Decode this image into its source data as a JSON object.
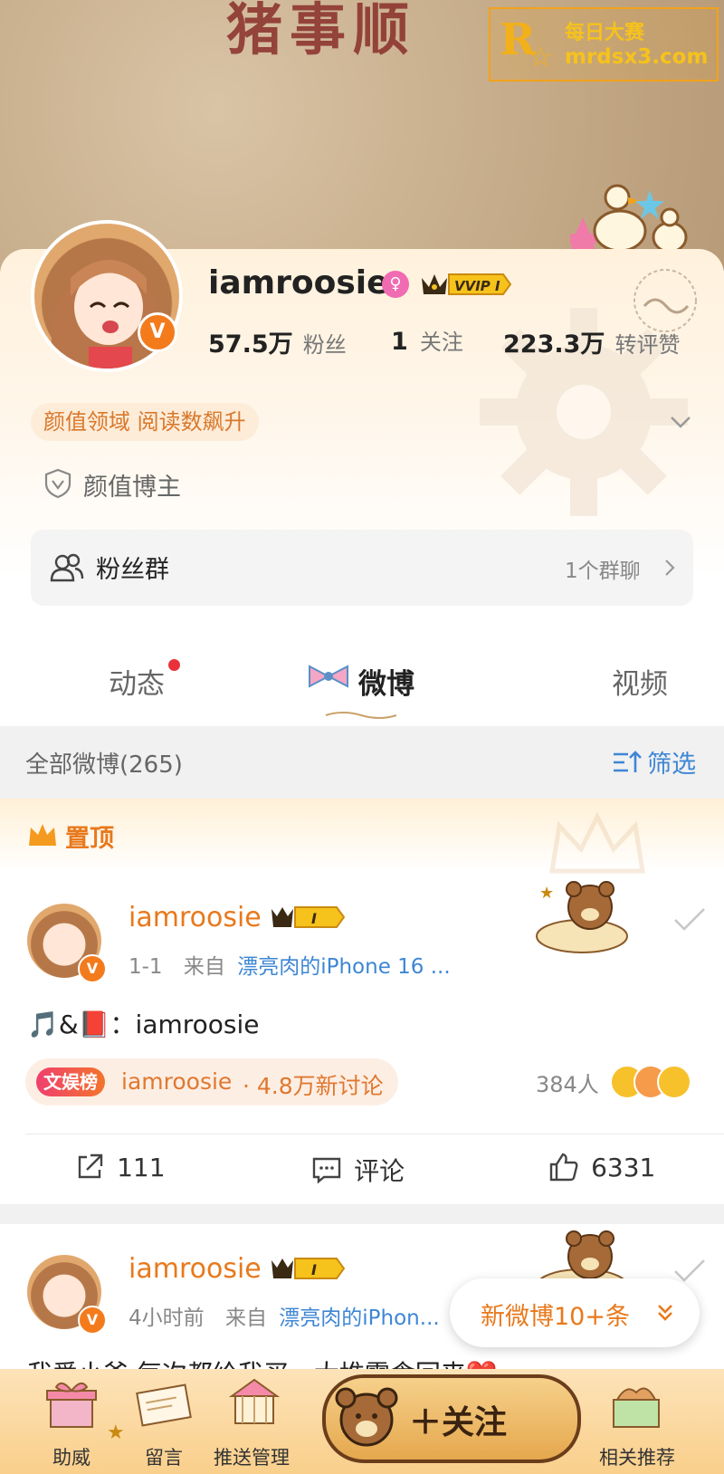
{
  "cover": {
    "title_text": "猪事顺"
  },
  "watermark": {
    "logo": "R",
    "line1": "每日大赛",
    "line2": "mrdsx3.com"
  },
  "profile": {
    "username": "iamroosie",
    "vvip_label": "VVIP I",
    "stats": [
      {
        "value": "57.5万",
        "label": "粉丝"
      },
      {
        "value": "1",
        "label": "关注"
      },
      {
        "value": "223.3万",
        "label": "转评赞"
      }
    ],
    "tag": "颜值领域 阅读数飙升",
    "role": "颜值博主",
    "fan_group": {
      "label": "粉丝群",
      "right": "1个群聊"
    }
  },
  "tabs": [
    {
      "label": "动态",
      "has_dot": true
    },
    {
      "label": "微博",
      "active": true
    },
    {
      "label": "视频"
    }
  ],
  "feed": {
    "all_posts": "全部微博(265)",
    "filter": "筛选"
  },
  "pinned": {
    "label": "置顶"
  },
  "posts": [
    {
      "name": "iamroosie",
      "crown_level": "I",
      "time": "1-1",
      "source_prefix": "来自",
      "source": "漂亮肉的iPhone 16 ...",
      "text": "🎵&📕：iamroosie",
      "topic": {
        "badge": "文娱榜",
        "name": "iamroosie",
        "count": "· 4.8万新讨论"
      },
      "people": "384人",
      "actions": {
        "repost": "111",
        "comment": "评论",
        "like": "6331"
      }
    },
    {
      "name": "iamroosie",
      "crown_level": "I",
      "time": "4小时前",
      "source_prefix": "来自",
      "source": "漂亮肉的iPhon...",
      "text": "我爱小爸 每次都给我买一大堆零食回来❤️"
    }
  ],
  "toast": {
    "label": "新微博10+条"
  },
  "bottom_bar": {
    "items": [
      {
        "label": "助威"
      },
      {
        "label": "留言"
      },
      {
        "label": "推送管理"
      },
      {
        "label": "相关推荐"
      }
    ],
    "follow": "＋关注"
  },
  "colors": {
    "brand_orange": "#e8791c",
    "link_blue": "#3e86d4",
    "vip_badge": "#f47b1c"
  }
}
